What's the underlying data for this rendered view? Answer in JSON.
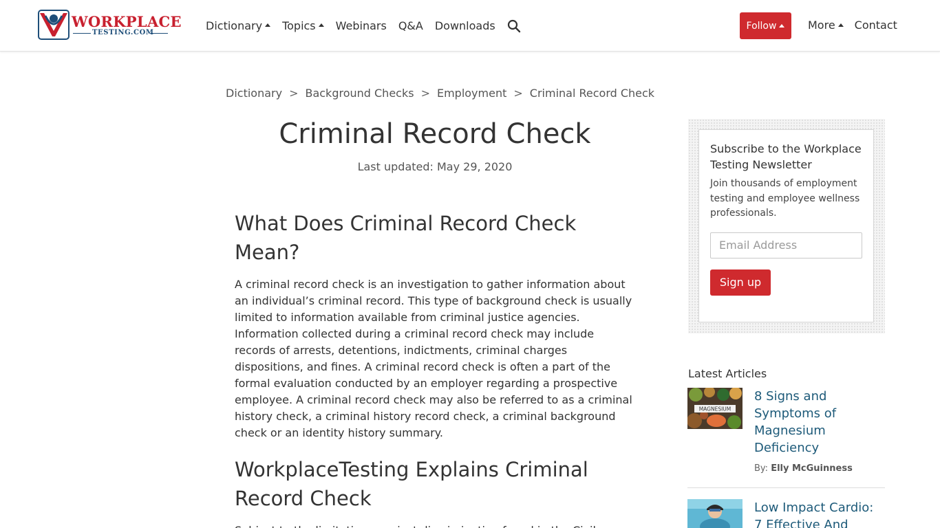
{
  "brand": {
    "logo_main": "WORKPLACE",
    "logo_sub": "TESTING.COM",
    "primary_color": "#cf2a2e",
    "secondary_color": "#1e4e79",
    "link_color": "#1d5a79"
  },
  "nav": {
    "items": [
      {
        "label": "Dictionary",
        "caret": "caret-up-icon"
      },
      {
        "label": "Topics",
        "caret": "caret-up-icon"
      },
      {
        "label": "Webinars"
      },
      {
        "label": "Q&A"
      },
      {
        "label": "Downloads"
      }
    ],
    "search_icon": "search-icon",
    "follow_label": "Follow",
    "right_items": [
      {
        "label": "More",
        "caret": "caret-up-icon"
      },
      {
        "label": "Contact"
      }
    ]
  },
  "breadcrumb": {
    "items": [
      "Dictionary",
      "Background Checks",
      "Employment",
      "Criminal Record Check"
    ],
    "separator": ">"
  },
  "page": {
    "title": "Criminal Record Check",
    "updated": "Last updated: May 29, 2020"
  },
  "article": {
    "heading1": "What Does Criminal Record Check Mean?",
    "paragraph1": "A criminal record check is an investigation to gather information about an individual’s criminal record. This type of background check is usually limited to information available from criminal justice agencies. Information collected during a criminal record check may include records of arrests, detentions, indictments, criminal charges dispositions, and fines. A criminal record check is often a part of the formal evaluation conducted by an employer regarding a prospective employee. A criminal record check may also be referred to as a criminal history check, a criminal history record check, a criminal background check or an identity history summary.",
    "heading2": "WorkplaceTesting Explains Criminal Record Check",
    "paragraph2": "Subject to the limitations against discrimination found in the Civil"
  },
  "subscribe": {
    "title": "Subscribe to the Workplace Testing Newsletter",
    "text": "Join thousands of employment testing and employee wellness professionals.",
    "email_placeholder": "Email Address",
    "button_label": "Sign up"
  },
  "latest": {
    "heading": "Latest Articles",
    "articles": [
      {
        "title": "8 Signs and Symptoms of Magnesium Deficiency",
        "by_label": "By:",
        "author": "Elly McGuinness",
        "thumb_label": "MAGNESIUM"
      },
      {
        "title": "Low Impact Cardio: 7 Effective And",
        "by_label": "",
        "author": ""
      }
    ]
  }
}
